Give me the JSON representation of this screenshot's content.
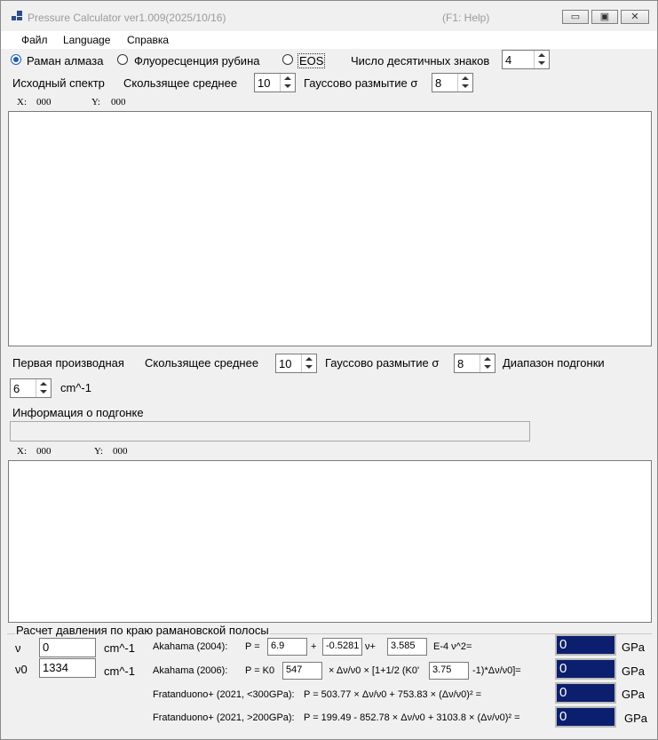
{
  "window": {
    "title": "Pressure Calculator  ver1.009(2025/10/16)",
    "help": "(F1: Help)",
    "minimize_glyph": "▭",
    "maximize_glyph": "▣",
    "close_glyph": "✕"
  },
  "menu": [
    "Файл",
    "Language",
    "Справка"
  ],
  "mode": {
    "options": [
      "Раман алмаза",
      "Флуоресценция рубина",
      "EOS"
    ],
    "selected": "Раман алмаза"
  },
  "decimals": {
    "label": "Число десятичных знаков",
    "value": "4"
  },
  "spectrum": {
    "label": "Исходный спектр",
    "moving_avg_label": "Скользящее среднее",
    "moving_avg_value": "10",
    "gauss_label": "Гауссово размытие σ",
    "gauss_value": "8",
    "x_label": "X:",
    "x_value": "000",
    "y_label": "Y:",
    "y_value": "000"
  },
  "derivative": {
    "label": "Первая производная",
    "moving_avg_label": "Скользящее среднее",
    "moving_avg_value": "10",
    "gauss_label": "Гауссово размытие σ",
    "gauss_value": "8",
    "fit_range_label": "Диапазон подгонки",
    "fit_range_value": "6",
    "fit_range_unit": "cm^-1",
    "fit_info_label": "Информация о подгонке",
    "fit_info_value": "",
    "x_label": "X:",
    "x_value": "000",
    "y_label": "Y:",
    "y_value": "000"
  },
  "pressure": {
    "group_title": "Расчет давления по краю рамановской полосы",
    "nu_label": "ν",
    "nu_value": "0",
    "nu_unit": "cm^-1",
    "nu0_label": "ν0",
    "nu0_value": "1334",
    "nu0_unit": "cm^-1",
    "rows": [
      {
        "name": "Akahama (2004):",
        "p": "P =",
        "a": "6.9",
        "plus": "+",
        "b": "-0.5281",
        "mid": "ν+",
        "c": "3.585",
        "tail": "E-4 ν^2=",
        "result": "0",
        "unit": "GPa"
      },
      {
        "name": "Akahama (2006):",
        "p": "P = K0",
        "a": "547",
        "mid": "× Δν/ν0 × [1+1/2 (K0'",
        "c": "3.75",
        "tail": "-1)*Δν/ν0]=",
        "result": "0",
        "unit": "GPa"
      },
      {
        "name": "Fratanduono+ (2021, <300GPa):",
        "formula": "P = 503.77 × Δν/ν0 + 753.83 × (Δν/ν0)² =",
        "result": "0",
        "unit": "GPa"
      },
      {
        "name": "Fratanduono+ (2021, >200GPa):",
        "formula": "P = 199.49 - 852.78 × Δν/ν0 + 3103.8 × (Δν/ν0)² =",
        "result": "0",
        "unit": "GPa"
      }
    ]
  }
}
